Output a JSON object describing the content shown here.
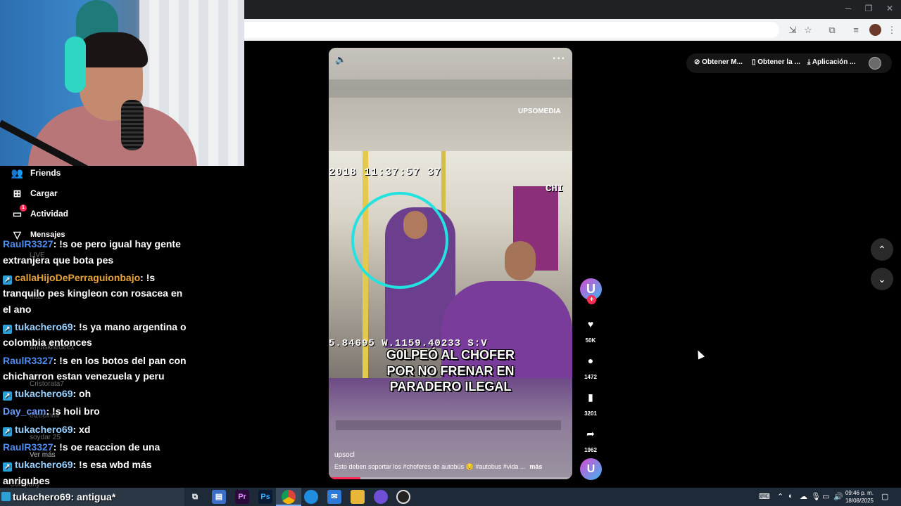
{
  "sidebar": {
    "nav": [
      {
        "label": "Friends",
        "icon": "friends-icon"
      },
      {
        "label": "Cargar",
        "icon": "upload-icon"
      },
      {
        "label": "Actividad",
        "icon": "activity-icon",
        "badge": "1"
      },
      {
        "label": "Mensajes",
        "icon": "messages-icon"
      }
    ],
    "ghost_labels": [
      "LIVE",
      "Más",
      "whoiskhedeex",
      "Cristorata7",
      "elzeeinmi",
      "soydar 25",
      "Ver más",
      "Company"
    ]
  },
  "chat": [
    {
      "user": "RaulR3327",
      "user_color": "#4f8cf0",
      "badge": false,
      "text": ": !s oe pero igual hay gente extranjera que bota pes"
    },
    {
      "user": "callaHijoDePerraguionbajo",
      "user_color": "#e8a33a",
      "badge": true,
      "text": ": !s tranquilo pes kingleon con rosacea en el ano"
    },
    {
      "user": "tukachero69",
      "user_color": "#9ad1ff",
      "badge": true,
      "text": ": !s ya mano argentina o colombia entonces"
    },
    {
      "user": "RaulR3327",
      "user_color": "#4f8cf0",
      "badge": false,
      "text": ": !s en los botos del pan con chicharron estan venezuela y peru"
    },
    {
      "user": "tukachero69",
      "user_color": "#9ad1ff",
      "badge": true,
      "text": ": oh"
    },
    {
      "user": "Day_cam",
      "user_color": "#6b9cff",
      "badge": false,
      "text": ": !s holi bro"
    },
    {
      "user": "tukachero69",
      "user_color": "#9ad1ff",
      "badge": true,
      "text": ": xd"
    },
    {
      "user": "RaulR3327",
      "user_color": "#4f8cf0",
      "badge": false,
      "text": ": !s oe reaccion de una"
    },
    {
      "user": "tukachero69",
      "user_color": "#9ad1ff",
      "badge": true,
      "text": ": !s esa wbd más anrigubes"
    }
  ],
  "taskbar_chat": {
    "user": "tukachero69",
    "text": ": antigua*"
  },
  "video": {
    "watermark": "UPSOMEDIA",
    "hud_top": "2018 11:37:57 37",
    "hud_right": "CHI",
    "hud_bottom": "5.84695 W.1159.40233 S:V",
    "caption_lines": [
      "G0LPEÓ AL CHOFER",
      "POR NO FRENAR EN",
      "PARADERO ILEGAL"
    ],
    "username": "upsocl",
    "description": "Esto deben soportar los #choferes de autobús 😔 #autobus #vida ...",
    "more_label": "más",
    "progress": 0.13
  },
  "actions": {
    "likes": "50K",
    "comments": "1472",
    "saves": "3201",
    "shares": "1962",
    "creator_initial": "U"
  },
  "topright": {
    "item1": "Obtener M...",
    "item2": "Obtener la ...",
    "item3": "Aplicación ..."
  },
  "clock": {
    "time": "09:46 p. m.",
    "date": "18/08/2025"
  },
  "colors": {
    "accent": "#fe2c55",
    "highlight_circle": "#22e3df"
  }
}
